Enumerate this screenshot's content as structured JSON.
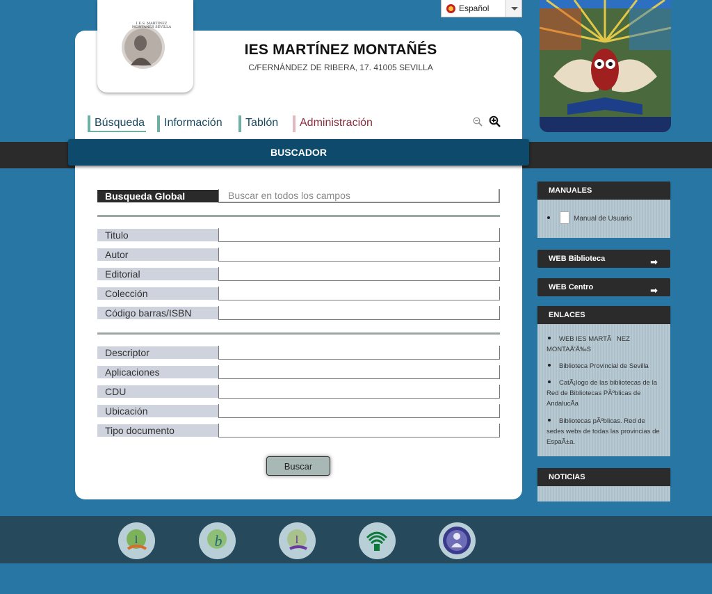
{
  "header": {
    "title": "IES MARTÍNEZ MONTAÑÉS",
    "subtitle": "C/FERNÁNDEZ DE RIBERA, 17. 41005 SEVILLA",
    "logo_text": "I.E.S. MARTINEZ MONTAÑÉS SEVILLA"
  },
  "language": {
    "selected": "Español"
  },
  "nav": {
    "busqueda": "Búsqueda",
    "informacion": "Información",
    "tablon": "Tablón",
    "administracion": "Administración"
  },
  "buscador": {
    "title": "BUSCADOR",
    "global_label": "Busqueda Global",
    "global_placeholder": "Buscar en todos los campos",
    "fields_group1": [
      "Titulo",
      "Autor",
      "Editorial",
      "Colección",
      "Código barras/ISBN"
    ],
    "fields_group2": [
      "Descriptor",
      "Aplicaciones",
      "CDU",
      "Ubicación",
      "Tipo documento"
    ],
    "submit_label": "Buscar"
  },
  "sidebar": {
    "manuales": {
      "title": "MANUALES",
      "items": [
        "Manual de Usuario"
      ]
    },
    "web_biblioteca": "WEB Biblioteca",
    "web_centro": "WEB Centro",
    "enlaces": {
      "title": "ENLACES",
      "items": [
        "WEB IES MARTÃNEZ MONTAÃ'Ã‰S",
        "Biblioteca Provincial de Sevilla",
        "CatÃ¡logo de las bibliotecas de la Red de Bibliotecas PÃºblicas de AndalucÃ­a",
        "Bibliotecas pÃºblicas. Red de sedes webs de todas las provincias de EspaÃ±a."
      ]
    },
    "noticias": {
      "title": "NOTICIAS"
    }
  },
  "colors": {
    "background": "#2776a3",
    "buscador_bar": "#0e4a6b",
    "nav_accent": "#6fb0a4",
    "admin_accent": "#e4b8c0"
  }
}
